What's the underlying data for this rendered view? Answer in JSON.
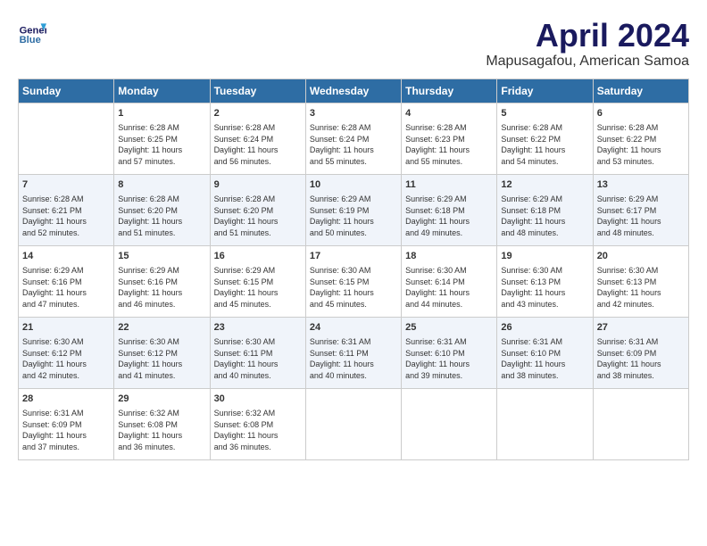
{
  "header": {
    "logo_line1": "General",
    "logo_line2": "Blue",
    "month": "April 2024",
    "location": "Mapusagafou, American Samoa"
  },
  "days_of_week": [
    "Sunday",
    "Monday",
    "Tuesday",
    "Wednesday",
    "Thursday",
    "Friday",
    "Saturday"
  ],
  "weeks": [
    [
      {
        "day": "",
        "info": ""
      },
      {
        "day": "1",
        "info": "Sunrise: 6:28 AM\nSunset: 6:25 PM\nDaylight: 11 hours\nand 57 minutes."
      },
      {
        "day": "2",
        "info": "Sunrise: 6:28 AM\nSunset: 6:24 PM\nDaylight: 11 hours\nand 56 minutes."
      },
      {
        "day": "3",
        "info": "Sunrise: 6:28 AM\nSunset: 6:24 PM\nDaylight: 11 hours\nand 55 minutes."
      },
      {
        "day": "4",
        "info": "Sunrise: 6:28 AM\nSunset: 6:23 PM\nDaylight: 11 hours\nand 55 minutes."
      },
      {
        "day": "5",
        "info": "Sunrise: 6:28 AM\nSunset: 6:22 PM\nDaylight: 11 hours\nand 54 minutes."
      },
      {
        "day": "6",
        "info": "Sunrise: 6:28 AM\nSunset: 6:22 PM\nDaylight: 11 hours\nand 53 minutes."
      }
    ],
    [
      {
        "day": "7",
        "info": "Sunrise: 6:28 AM\nSunset: 6:21 PM\nDaylight: 11 hours\nand 52 minutes."
      },
      {
        "day": "8",
        "info": "Sunrise: 6:28 AM\nSunset: 6:20 PM\nDaylight: 11 hours\nand 51 minutes."
      },
      {
        "day": "9",
        "info": "Sunrise: 6:28 AM\nSunset: 6:20 PM\nDaylight: 11 hours\nand 51 minutes."
      },
      {
        "day": "10",
        "info": "Sunrise: 6:29 AM\nSunset: 6:19 PM\nDaylight: 11 hours\nand 50 minutes."
      },
      {
        "day": "11",
        "info": "Sunrise: 6:29 AM\nSunset: 6:18 PM\nDaylight: 11 hours\nand 49 minutes."
      },
      {
        "day": "12",
        "info": "Sunrise: 6:29 AM\nSunset: 6:18 PM\nDaylight: 11 hours\nand 48 minutes."
      },
      {
        "day": "13",
        "info": "Sunrise: 6:29 AM\nSunset: 6:17 PM\nDaylight: 11 hours\nand 48 minutes."
      }
    ],
    [
      {
        "day": "14",
        "info": "Sunrise: 6:29 AM\nSunset: 6:16 PM\nDaylight: 11 hours\nand 47 minutes."
      },
      {
        "day": "15",
        "info": "Sunrise: 6:29 AM\nSunset: 6:16 PM\nDaylight: 11 hours\nand 46 minutes."
      },
      {
        "day": "16",
        "info": "Sunrise: 6:29 AM\nSunset: 6:15 PM\nDaylight: 11 hours\nand 45 minutes."
      },
      {
        "day": "17",
        "info": "Sunrise: 6:30 AM\nSunset: 6:15 PM\nDaylight: 11 hours\nand 45 minutes."
      },
      {
        "day": "18",
        "info": "Sunrise: 6:30 AM\nSunset: 6:14 PM\nDaylight: 11 hours\nand 44 minutes."
      },
      {
        "day": "19",
        "info": "Sunrise: 6:30 AM\nSunset: 6:13 PM\nDaylight: 11 hours\nand 43 minutes."
      },
      {
        "day": "20",
        "info": "Sunrise: 6:30 AM\nSunset: 6:13 PM\nDaylight: 11 hours\nand 42 minutes."
      }
    ],
    [
      {
        "day": "21",
        "info": "Sunrise: 6:30 AM\nSunset: 6:12 PM\nDaylight: 11 hours\nand 42 minutes."
      },
      {
        "day": "22",
        "info": "Sunrise: 6:30 AM\nSunset: 6:12 PM\nDaylight: 11 hours\nand 41 minutes."
      },
      {
        "day": "23",
        "info": "Sunrise: 6:30 AM\nSunset: 6:11 PM\nDaylight: 11 hours\nand 40 minutes."
      },
      {
        "day": "24",
        "info": "Sunrise: 6:31 AM\nSunset: 6:11 PM\nDaylight: 11 hours\nand 40 minutes."
      },
      {
        "day": "25",
        "info": "Sunrise: 6:31 AM\nSunset: 6:10 PM\nDaylight: 11 hours\nand 39 minutes."
      },
      {
        "day": "26",
        "info": "Sunrise: 6:31 AM\nSunset: 6:10 PM\nDaylight: 11 hours\nand 38 minutes."
      },
      {
        "day": "27",
        "info": "Sunrise: 6:31 AM\nSunset: 6:09 PM\nDaylight: 11 hours\nand 38 minutes."
      }
    ],
    [
      {
        "day": "28",
        "info": "Sunrise: 6:31 AM\nSunset: 6:09 PM\nDaylight: 11 hours\nand 37 minutes."
      },
      {
        "day": "29",
        "info": "Sunrise: 6:32 AM\nSunset: 6:08 PM\nDaylight: 11 hours\nand 36 minutes."
      },
      {
        "day": "30",
        "info": "Sunrise: 6:32 AM\nSunset: 6:08 PM\nDaylight: 11 hours\nand 36 minutes."
      },
      {
        "day": "",
        "info": ""
      },
      {
        "day": "",
        "info": ""
      },
      {
        "day": "",
        "info": ""
      },
      {
        "day": "",
        "info": ""
      }
    ]
  ]
}
